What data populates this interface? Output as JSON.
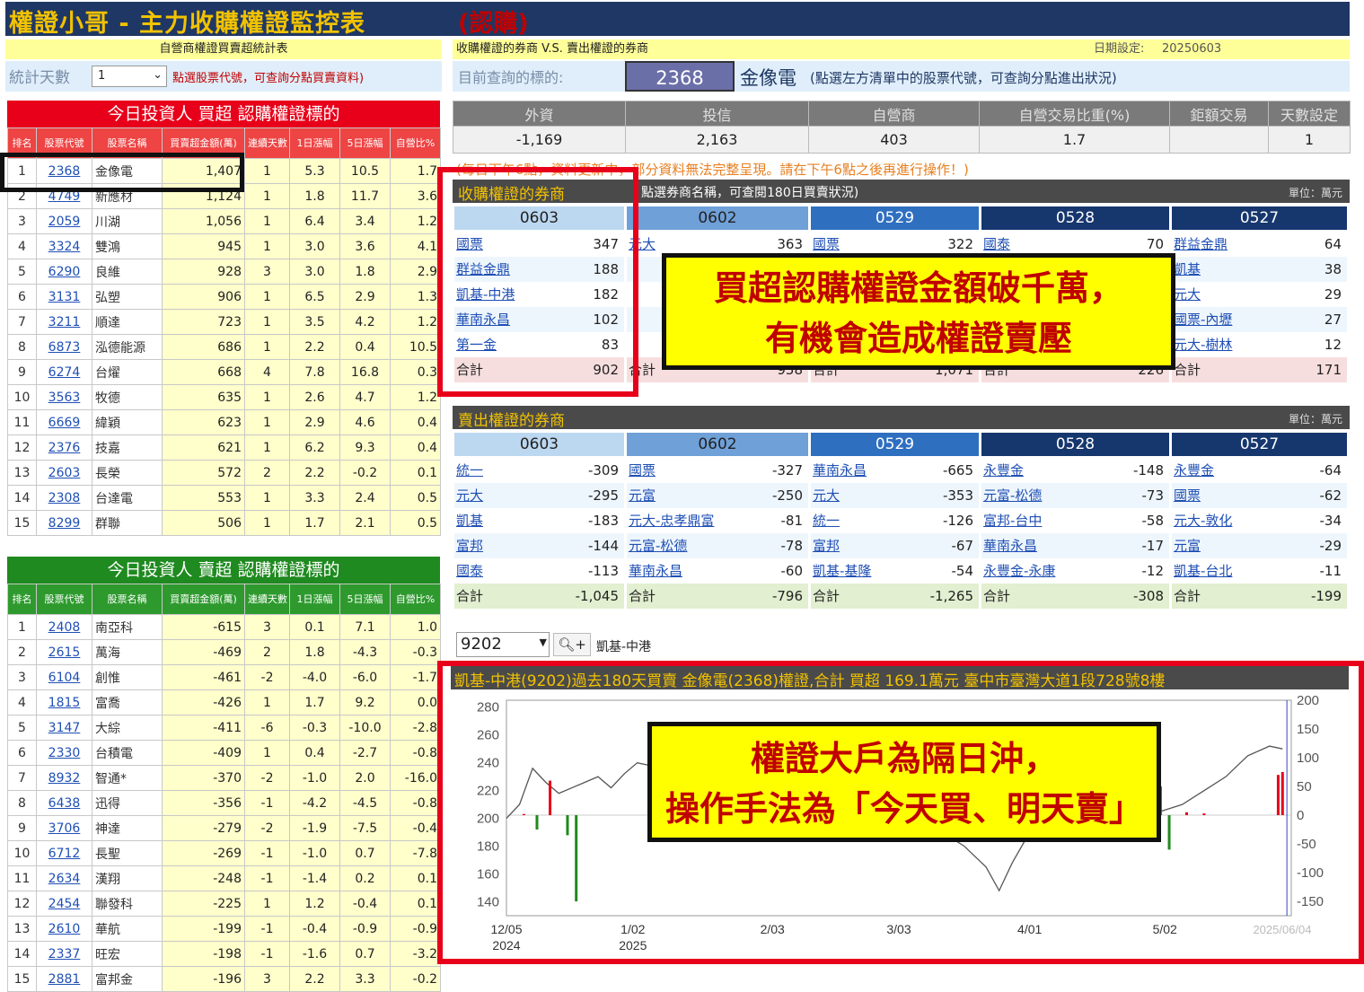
{
  "header": {
    "title": "權證小哥 - 主力收購權證監控表",
    "title_suffix": "(認購)"
  },
  "left_bar": {
    "title": "自營商權證買賣超統計表",
    "days_label": "統計天數",
    "days_value": "1",
    "hint": "點選股票代號，可查詢分點買賣資料)"
  },
  "right_bar": {
    "title": "收購權證的券商 V.S. 賣出權證的券商",
    "date_label": "日期設定:",
    "date_value": "20250603",
    "query_label": "目前查詢的標的:",
    "query_code": "2368",
    "query_name": "金像電",
    "query_hint": "(點選左方清單中的股票代號，可查詢分點進出狀況)"
  },
  "buy_table": {
    "title": "今日投資人 買超 認購權證標的",
    "headers": [
      "排名",
      "股票代號",
      "股票名稱",
      "買賣超金額(萬)",
      "連續天數",
      "1日漲幅",
      "5日漲幅",
      "自營比%"
    ],
    "rows": [
      [
        "1",
        "2368",
        "金像電",
        "1,407",
        "1",
        "5.3",
        "10.5",
        "1.7"
      ],
      [
        "2",
        "4749",
        "新應材",
        "1,124",
        "1",
        "1.8",
        "11.7",
        "3.6"
      ],
      [
        "3",
        "2059",
        "川湖",
        "1,056",
        "1",
        "6.4",
        "3.4",
        "1.2"
      ],
      [
        "4",
        "3324",
        "雙鴻",
        "945",
        "1",
        "3.0",
        "3.6",
        "4.1"
      ],
      [
        "5",
        "6290",
        "良維",
        "928",
        "3",
        "3.0",
        "1.8",
        "2.9"
      ],
      [
        "6",
        "3131",
        "弘塑",
        "906",
        "1",
        "6.5",
        "2.9",
        "1.3"
      ],
      [
        "7",
        "3211",
        "順達",
        "723",
        "1",
        "3.5",
        "4.2",
        "1.2"
      ],
      [
        "8",
        "6873",
        "泓德能源",
        "686",
        "1",
        "2.2",
        "0.4",
        "10.5"
      ],
      [
        "9",
        "6274",
        "台燿",
        "668",
        "4",
        "7.8",
        "16.8",
        "0.3"
      ],
      [
        "10",
        "3563",
        "牧德",
        "635",
        "1",
        "2.6",
        "4.7",
        "1.2"
      ],
      [
        "11",
        "6669",
        "緯穎",
        "623",
        "1",
        "2.9",
        "4.6",
        "0.4"
      ],
      [
        "12",
        "2376",
        "技嘉",
        "621",
        "1",
        "6.2",
        "9.3",
        "0.4"
      ],
      [
        "13",
        "2603",
        "長榮",
        "572",
        "2",
        "2.2",
        "-0.2",
        "0.1"
      ],
      [
        "14",
        "2308",
        "台達電",
        "553",
        "1",
        "3.3",
        "2.4",
        "0.5"
      ],
      [
        "15",
        "8299",
        "群聯",
        "506",
        "1",
        "1.7",
        "2.1",
        "0.5"
      ]
    ]
  },
  "sell_table": {
    "title": "今日投資人 賣超 認購權證標的",
    "headers": [
      "排名",
      "股票代號",
      "股票名稱",
      "買賣超金額(萬)",
      "連續天數",
      "1日漲幅",
      "5日漲幅",
      "自營比%"
    ],
    "rows": [
      [
        "1",
        "2408",
        "南亞科",
        "-615",
        "3",
        "0.1",
        "7.1",
        "1.0"
      ],
      [
        "2",
        "2615",
        "萬海",
        "-469",
        "2",
        "1.8",
        "-4.3",
        "-0.3"
      ],
      [
        "3",
        "6104",
        "創惟",
        "-461",
        "-2",
        "-4.0",
        "-6.0",
        "-1.7"
      ],
      [
        "4",
        "1815",
        "富喬",
        "-426",
        "1",
        "1.7",
        "9.2",
        "0.0"
      ],
      [
        "5",
        "3147",
        "大綜",
        "-411",
        "-6",
        "-0.3",
        "-10.0",
        "-2.8"
      ],
      [
        "6",
        "2330",
        "台積電",
        "-409",
        "1",
        "0.4",
        "-2.7",
        "-0.8"
      ],
      [
        "7",
        "8932",
        "智通*",
        "-370",
        "-2",
        "-1.0",
        "2.0",
        "-16.0"
      ],
      [
        "8",
        "6438",
        "迅得",
        "-356",
        "-1",
        "-4.2",
        "-4.5",
        "-0.8"
      ],
      [
        "9",
        "3706",
        "神達",
        "-279",
        "-2",
        "-1.9",
        "-7.5",
        "-0.4"
      ],
      [
        "10",
        "6712",
        "長聖",
        "-269",
        "-1",
        "-1.0",
        "0.7",
        "-7.8"
      ],
      [
        "11",
        "2634",
        "漢翔",
        "-248",
        "-1",
        "-1.4",
        "0.2",
        "0.1"
      ],
      [
        "12",
        "2454",
        "聯發科",
        "-225",
        "1",
        "1.2",
        "-0.4",
        "0.1"
      ],
      [
        "13",
        "2610",
        "華航",
        "-199",
        "-1",
        "-0.4",
        "-0.9",
        "-0.9"
      ],
      [
        "14",
        "2337",
        "旺宏",
        "-198",
        "-1",
        "-1.6",
        "0.7",
        "-3.2"
      ],
      [
        "15",
        "2881",
        "富邦金",
        "-196",
        "3",
        "2.2",
        "3.3",
        "-0.2"
      ]
    ]
  },
  "stats": {
    "headers": [
      "外資",
      "投信",
      "自營商",
      "自營交易比重(%)",
      "鉅額交易",
      "天數設定"
    ],
    "values": [
      "-1,169",
      "2,163",
      "403",
      "1.7",
      "",
      "1"
    ],
    "notice": "(每日下午6點，資料更新中，部分資料無法完整呈現。請在下午6點之後再進行操作！)"
  },
  "buy_brokers": {
    "title": "收購權證的券商",
    "hint": "點選券商名稱，可查閱180日買賣狀況)",
    "unit": "單位：萬元",
    "columns": [
      {
        "date": "0603",
        "rows": [
          [
            "國票",
            "347"
          ],
          [
            "群益金鼎",
            "188"
          ],
          [
            "凱基-中港",
            "182"
          ],
          [
            "華南永昌",
            "102"
          ],
          [
            "第一金",
            "83"
          ]
        ],
        "total": "902"
      },
      {
        "date": "0602",
        "rows": [
          [
            "元大",
            "363"
          ],
          [
            "",
            "",
            ""
          ],
          [
            "",
            "",
            ""
          ],
          [
            "",
            "",
            ""
          ],
          [
            "",
            "",
            ""
          ]
        ],
        "total": "958"
      },
      {
        "date": "0529",
        "rows": [
          [
            "國票",
            "322"
          ],
          [
            "",
            "",
            ""
          ],
          [
            "",
            "",
            ""
          ],
          [
            "",
            "",
            ""
          ],
          [
            "",
            "",
            ""
          ]
        ],
        "total": "1,071"
      },
      {
        "date": "0528",
        "rows": [
          [
            "國泰",
            "70"
          ],
          [
            "",
            "",
            ""
          ],
          [
            "",
            "",
            ""
          ],
          [
            "",
            "",
            ""
          ],
          [
            "",
            "",
            ""
          ]
        ],
        "total": "226"
      },
      {
        "date": "0527",
        "rows": [
          [
            "群益金鼎",
            "64"
          ],
          [
            "凱基",
            "38"
          ],
          [
            "元大",
            "29"
          ],
          [
            "國票-內壢",
            "27"
          ],
          [
            "元大-樹林",
            "12"
          ]
        ],
        "total": "171"
      }
    ]
  },
  "sell_brokers": {
    "title": "賣出權證的券商",
    "unit": "單位：萬元",
    "columns": [
      {
        "date": "0603",
        "rows": [
          [
            "統一",
            "-309"
          ],
          [
            "元大",
            "-295"
          ],
          [
            "凱基",
            "-183"
          ],
          [
            "富邦",
            "-144"
          ],
          [
            "國泰",
            "-113"
          ]
        ],
        "total": "-1,045"
      },
      {
        "date": "0602",
        "rows": [
          [
            "國票",
            "-327"
          ],
          [
            "元富",
            "-250"
          ],
          [
            "元大-忠孝鼎富",
            "-81"
          ],
          [
            "元富-松德",
            "-78"
          ],
          [
            "華南永昌",
            "-60"
          ]
        ],
        "total": "-796"
      },
      {
        "date": "0529",
        "rows": [
          [
            "華南永昌",
            "-665"
          ],
          [
            "元大",
            "-353"
          ],
          [
            "統一",
            "-126"
          ],
          [
            "富邦",
            "-67"
          ],
          [
            "凱基-基隆",
            "-54"
          ]
        ],
        "total": "-1,265"
      },
      {
        "date": "0528",
        "rows": [
          [
            "永豐金",
            "-148"
          ],
          [
            "元富-松德",
            "-73"
          ],
          [
            "富邦-台中",
            "-58"
          ],
          [
            "華南永昌",
            "-17"
          ],
          [
            "永豐金-永康",
            "-12"
          ]
        ],
        "total": "-308"
      },
      {
        "date": "0527",
        "rows": [
          [
            "永豐金",
            "-64"
          ],
          [
            "國票",
            "-62"
          ],
          [
            "元大-敦化",
            "-34"
          ],
          [
            "元富",
            "-29"
          ],
          [
            "凱基-台北",
            "-11"
          ]
        ],
        "total": "-199"
      }
    ]
  },
  "total_label": "合計",
  "broker_select": {
    "code": "9202",
    "name": "凱基-中港"
  },
  "chart_data": {
    "type": "line",
    "title": "凱基-中港(9202)過去180天買賣 金像電(2368)權證,合計 買超 169.1萬元 臺中市臺灣大道1段728號8樓",
    "left_ticks": [
      "280",
      "260",
      "240",
      "220",
      "200",
      "180",
      "160",
      "140"
    ],
    "right_ticks": [
      "200",
      "150",
      "100",
      "50",
      "0",
      "-50",
      "-100",
      "-150"
    ],
    "x_ticks": [
      "12/05",
      "1/02",
      "2/03",
      "3/03",
      "4/01",
      "5/02"
    ],
    "x_years": [
      "2024",
      "2025"
    ],
    "end_date": "2025/06/04",
    "price_line": [
      [
        0,
        200
      ],
      [
        3,
        210
      ],
      [
        6,
        236
      ],
      [
        9,
        226
      ],
      [
        12,
        218
      ],
      [
        15,
        222
      ],
      [
        18,
        226
      ],
      [
        21,
        230
      ],
      [
        24,
        222
      ],
      [
        27,
        232
      ],
      [
        30,
        240
      ],
      [
        33,
        238
      ],
      [
        36,
        234
      ],
      [
        40,
        228
      ],
      [
        45,
        224
      ],
      [
        50,
        226
      ],
      [
        55,
        222
      ],
      [
        60,
        226
      ],
      [
        65,
        222
      ],
      [
        70,
        218
      ],
      [
        75,
        214
      ],
      [
        80,
        210
      ],
      [
        85,
        205
      ],
      [
        90,
        200
      ],
      [
        95,
        196
      ],
      [
        100,
        190
      ],
      [
        105,
        180
      ],
      [
        110,
        165
      ],
      [
        113,
        148
      ],
      [
        116,
        168
      ],
      [
        120,
        190
      ],
      [
        125,
        200
      ],
      [
        130,
        204
      ],
      [
        135,
        200
      ],
      [
        140,
        195
      ],
      [
        145,
        200
      ],
      [
        150,
        205
      ],
      [
        155,
        210
      ],
      [
        160,
        220
      ],
      [
        165,
        230
      ],
      [
        170,
        245
      ],
      [
        175,
        252
      ],
      [
        178,
        250
      ]
    ],
    "volume_bars": [
      [
        4,
        2
      ],
      [
        7,
        -25
      ],
      [
        10,
        60
      ],
      [
        14,
        -35
      ],
      [
        16,
        -150
      ],
      [
        95,
        -20
      ],
      [
        150,
        50
      ],
      [
        152,
        -60
      ],
      [
        156,
        5
      ],
      [
        160,
        3
      ],
      [
        177,
        70
      ],
      [
        178,
        75
      ]
    ]
  },
  "callouts": {
    "top": "買超認購權證金額破千萬，有機會造成權證賣壓",
    "bottom": "權證大戶為隔日沖，操作手法為「今天買、明天賣」"
  },
  "colors": {
    "title_bg": "#1f3764",
    "buy_red": "#e8001a",
    "sell_green": "#1f8a1f",
    "highlight": "#ffff00"
  }
}
